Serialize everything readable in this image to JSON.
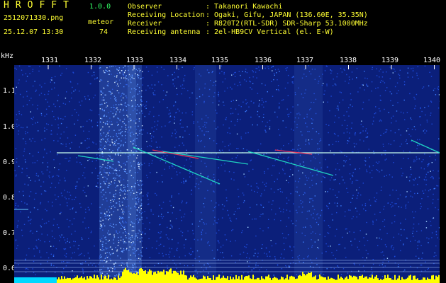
{
  "header": {
    "app_title": "HROFFT",
    "app_version": "1.0.0",
    "filename": "2512071330.png",
    "datetime": "25.12.07 13:30",
    "meteor_label": "meteor",
    "meteor_count": "74",
    "info": [
      {
        "key": "Observer",
        "value": ": Takanori Kawachi"
      },
      {
        "key": "Receiving Location",
        "value": ": Ogaki, Gifu, JAPAN (136.60E, 35.35N)"
      },
      {
        "key": "Receiver",
        "value": ": R820T2(RTL-SDR) SDR-Sharp 53.1000MHz"
      },
      {
        "key": "Receiving antenna",
        "value": ": 2el-HB9CV Vertical (el. E-W)"
      }
    ]
  },
  "axis": {
    "y_unit": "kHz",
    "x_ticks": [
      "1331",
      "1332",
      "1333",
      "1334",
      "1335",
      "1336",
      "1337",
      "1338",
      "1339",
      "1340"
    ],
    "y_ticks": [
      "1.1",
      "1.0",
      "0.9",
      "0.8",
      "0.7",
      "0.6"
    ]
  },
  "colors": {
    "background": "#000000",
    "noise": "#1a3fd0",
    "header_text": "#ffff33",
    "trail_cyan": "#22e6c8",
    "trail_hot": "#ff3355",
    "signal_bar": "#ffff00",
    "signal_base": "#00d8ff"
  }
}
